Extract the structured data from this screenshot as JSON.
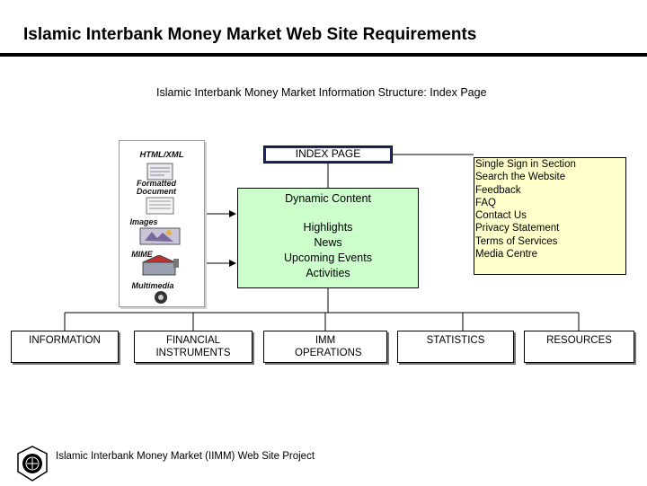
{
  "header": {
    "title": "Islamic Interbank Money Market Web Site Requirements"
  },
  "diagram": {
    "subtitle": "Islamic Interbank Money Market Information Structure:  Index Page",
    "index_box": "INDEX PAGE",
    "dynamic_content": {
      "title": "Dynamic Content",
      "items": [
        "Highlights",
        "News",
        "Upcoming Events",
        "Activities"
      ]
    },
    "links_box": {
      "items": [
        "Single Sign in Section",
        "Search the Website",
        "Feedback",
        "FAQ",
        "Contact Us",
        "Privacy Statement",
        "Terms of Services",
        "Media Centre"
      ]
    },
    "media_panel": {
      "labels": [
        "HTML/XML",
        "Formatted Document",
        "Images",
        "MIME",
        "Multimedia"
      ]
    },
    "sections": [
      {
        "label": "INFORMATION"
      },
      {
        "label": "FINANCIAL INSTRUMENTS"
      },
      {
        "label": "IMM OPERATIONS"
      },
      {
        "label": "STATISTICS"
      },
      {
        "label": "RESOURCES"
      }
    ]
  },
  "footer": {
    "text": "Islamic Interbank Money Market (IIMM) Web Site Project"
  },
  "colors": {
    "dynamic_fill": "#ccffcc",
    "links_fill": "#ffffcc",
    "rule": "#000000"
  }
}
